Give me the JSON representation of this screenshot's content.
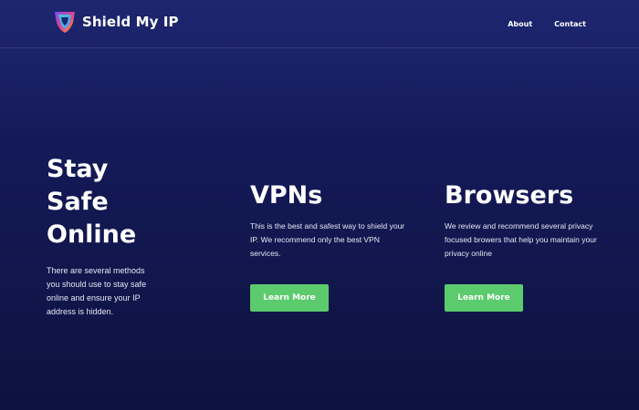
{
  "header": {
    "brand_name": "Shield My IP",
    "nav": [
      {
        "label": "About"
      },
      {
        "label": "Contact"
      }
    ]
  },
  "intro": {
    "heading": "Stay Safe Online",
    "text": "There are several methods you should use to stay safe online and ensure your IP address is hidden."
  },
  "cards": [
    {
      "title": "VPNs",
      "text": "This is the best and safest way to shield your IP. We recommend only the best VPN services.",
      "button_label": "Learn More"
    },
    {
      "title": "Browsers",
      "text": "We review and recommend several privacy focused browers that help you maintain your privacy online",
      "button_label": "Learn More"
    }
  ],
  "colors": {
    "background_top": "#1e2670",
    "background_bottom": "#0e1240",
    "button": "#5bcb6d",
    "text": "#ffffff"
  },
  "icons": {
    "logo": "shield-logo-icon"
  }
}
